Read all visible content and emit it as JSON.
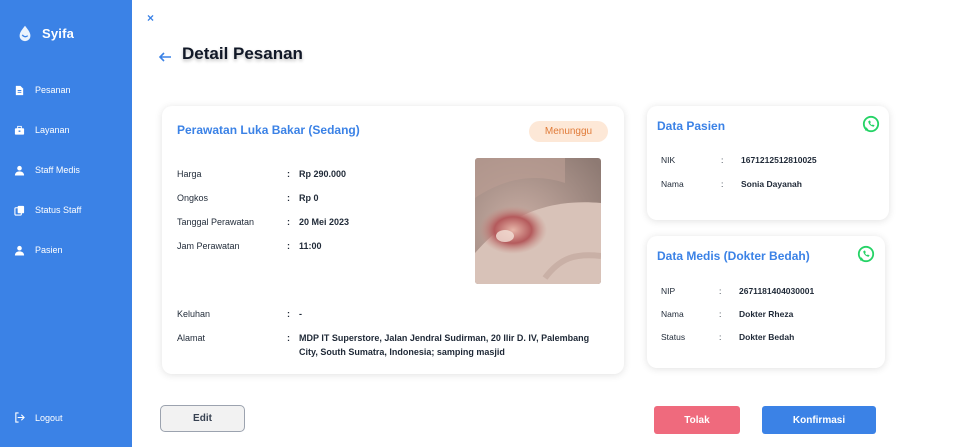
{
  "app": {
    "name": "Syifa"
  },
  "sidebar": {
    "items": [
      {
        "label": "Pesanan",
        "icon": "document-icon"
      },
      {
        "label": "Layanan",
        "icon": "briefcase-icon"
      },
      {
        "label": "Staff Medis",
        "icon": "user-icon"
      },
      {
        "label": "Status Staff",
        "icon": "copy-icon"
      },
      {
        "label": "Pasien",
        "icon": "user-icon"
      }
    ],
    "logout_label": "Logout"
  },
  "header": {
    "close_symbol": "×",
    "title": "Detail Pesanan"
  },
  "order": {
    "title": "Perawatan Luka Bakar (Sedang)",
    "status": "Menunggu",
    "fields": [
      {
        "label": "Harga",
        "value": "Rp 290.000"
      },
      {
        "label": "Ongkos",
        "value": "Rp 0"
      },
      {
        "label": "Tanggal Perawatan",
        "value": "20 Mei 2023"
      },
      {
        "label": "Jam Perawatan",
        "value": "11:00"
      },
      {
        "label": "Keluhan",
        "value": "-"
      },
      {
        "label": "Alamat",
        "value": "MDP IT Superstore, Jalan Jendral Sudirman, 20 Ilir D. IV, Palembang City, South Sumatra, Indonesia; samping masjid"
      }
    ],
    "colon": ":"
  },
  "patient": {
    "title": "Data Pasien",
    "fields": [
      {
        "label": "NIK",
        "value": "1671212512810025"
      },
      {
        "label": "Nama",
        "value": "Sonia Dayanah"
      }
    ]
  },
  "medic": {
    "title": "Data Medis (Dokter Bedah)",
    "fields": [
      {
        "label": "NIP",
        "value": "2671181404030001"
      },
      {
        "label": "Nama",
        "value": "Dokter Rheza"
      },
      {
        "label": "Status",
        "value": "Dokter Bedah"
      }
    ]
  },
  "actions": {
    "edit": "Edit",
    "reject": "Tolak",
    "confirm": "Konfirmasi"
  },
  "colors": {
    "primary": "#3b82e6",
    "badge_bg": "#fde8d7",
    "badge_text": "#e07b39",
    "reject": "#ef6a7d",
    "whatsapp": "#25d366"
  }
}
